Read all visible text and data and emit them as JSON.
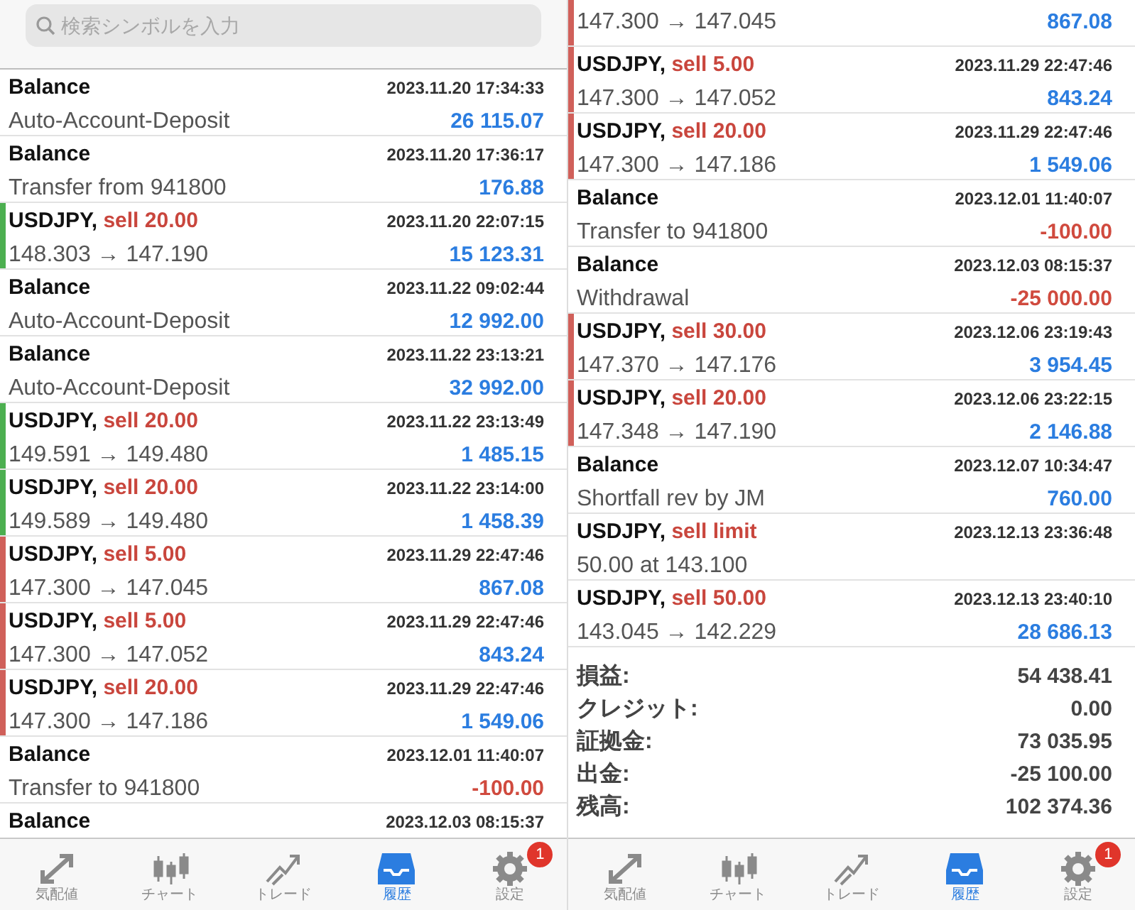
{
  "screens": [
    {
      "search": {
        "placeholder": "検索シンボルを入力"
      },
      "rows": [
        {
          "kind": "deal",
          "title": "Balance",
          "action": "",
          "time": "2023.11.20 17:34:33",
          "detail": "Auto-Account-Deposit",
          "amount": "26 115.07",
          "negative": false
        },
        {
          "kind": "deal",
          "title": "Balance",
          "action": "",
          "time": "2023.11.20 17:36:17",
          "detail": "Transfer from 941800",
          "amount": "176.88",
          "negative": false
        },
        {
          "kind": "deal",
          "title": "USDJPY,",
          "action": "sell 20.00",
          "time": "2023.11.20 22:07:15",
          "detail": "148.303 → 147.190",
          "amount": "15 123.31",
          "negative": false,
          "color": "#4caf50"
        },
        {
          "kind": "deal",
          "title": "Balance",
          "action": "",
          "time": "2023.11.22 09:02:44",
          "detail": "Auto-Account-Deposit",
          "amount": "12 992.00",
          "negative": false
        },
        {
          "kind": "deal",
          "title": "Balance",
          "action": "",
          "time": "2023.11.22 23:13:21",
          "detail": "Auto-Account-Deposit",
          "amount": "32 992.00",
          "negative": false
        },
        {
          "kind": "deal",
          "title": "USDJPY,",
          "action": "sell 20.00",
          "time": "2023.11.22 23:13:49",
          "detail": "149.591 → 149.480",
          "amount": "1 485.15",
          "negative": false,
          "color": "#4caf50"
        },
        {
          "kind": "deal",
          "title": "USDJPY,",
          "action": "sell 20.00",
          "time": "2023.11.22 23:14:00",
          "detail": "149.589 → 149.480",
          "amount": "1 458.39",
          "negative": false,
          "color": "#4caf50"
        },
        {
          "kind": "deal",
          "title": "USDJPY,",
          "action": "sell 5.00",
          "time": "2023.11.29 22:47:46",
          "detail": "147.300 → 147.045",
          "amount": "867.08",
          "negative": false,
          "color": "#d0605a"
        },
        {
          "kind": "deal",
          "title": "USDJPY,",
          "action": "sell 5.00",
          "time": "2023.11.29 22:47:46",
          "detail": "147.300 → 147.052",
          "amount": "843.24",
          "negative": false,
          "color": "#d0605a"
        },
        {
          "kind": "deal",
          "title": "USDJPY,",
          "action": "sell 20.00",
          "time": "2023.11.29 22:47:46",
          "detail": "147.300 → 147.186",
          "amount": "1 549.06",
          "negative": false,
          "color": "#d0605a"
        },
        {
          "kind": "deal",
          "title": "Balance",
          "action": "",
          "time": "2023.12.01 11:40:07",
          "detail": "Transfer to 941800",
          "amount": "-100.00",
          "negative": true
        },
        {
          "kind": "top",
          "title": "Balance",
          "action": "",
          "time": "2023.12.03 08:15:37"
        }
      ],
      "nav": [
        {
          "label": "気配値",
          "selected": false
        },
        {
          "label": "チャート",
          "selected": false
        },
        {
          "label": "トレード",
          "selected": false
        },
        {
          "label": "履歴",
          "selected": true
        },
        {
          "label": "設定",
          "selected": false,
          "badge": "1"
        }
      ]
    },
    {
      "rows": [
        {
          "kind": "bottom",
          "detail": "147.300 → 147.045",
          "amount": "867.08",
          "negative": false,
          "color": "#d0605a"
        },
        {
          "kind": "deal",
          "title": "USDJPY,",
          "action": "sell 5.00",
          "time": "2023.11.29 22:47:46",
          "detail": "147.300 → 147.052",
          "amount": "843.24",
          "negative": false,
          "color": "#d0605a"
        },
        {
          "kind": "deal",
          "title": "USDJPY,",
          "action": "sell 20.00",
          "time": "2023.11.29 22:47:46",
          "detail": "147.300 → 147.186",
          "amount": "1 549.06",
          "negative": false,
          "color": "#d0605a"
        },
        {
          "kind": "deal",
          "title": "Balance",
          "action": "",
          "time": "2023.12.01 11:40:07",
          "detail": "Transfer to 941800",
          "amount": "-100.00",
          "negative": true
        },
        {
          "kind": "deal",
          "title": "Balance",
          "action": "",
          "time": "2023.12.03 08:15:37",
          "detail": "Withdrawal",
          "amount": "-25 000.00",
          "negative": true
        },
        {
          "kind": "deal",
          "title": "USDJPY,",
          "action": "sell 30.00",
          "time": "2023.12.06 23:19:43",
          "detail": "147.370 → 147.176",
          "amount": "3 954.45",
          "negative": false,
          "color": "#d0605a"
        },
        {
          "kind": "deal",
          "title": "USDJPY,",
          "action": "sell 20.00",
          "time": "2023.12.06 23:22:15",
          "detail": "147.348 → 147.190",
          "amount": "2 146.88",
          "negative": false,
          "color": "#d0605a"
        },
        {
          "kind": "deal",
          "title": "Balance",
          "action": "",
          "time": "2023.12.07 10:34:47",
          "detail": "Shortfall rev by JM",
          "amount": "760.00",
          "negative": false
        },
        {
          "kind": "deal",
          "title": "USDJPY,",
          "action": "sell limit",
          "time": "2023.12.13 23:36:48",
          "detail": "50.00 at 143.100"
        },
        {
          "kind": "deal",
          "title": "USDJPY,",
          "action": "sell 50.00",
          "time": "2023.12.13 23:40:10",
          "detail": "143.045 → 142.229",
          "amount": "28 686.13",
          "negative": false
        }
      ],
      "summary": [
        {
          "label": "損益:",
          "value": "54 438.41"
        },
        {
          "label": "クレジット:",
          "value": "0.00"
        },
        {
          "label": "証拠金:",
          "value": "73 035.95"
        },
        {
          "label": "出金:",
          "value": "-25 100.00"
        },
        {
          "label": "残高:",
          "value": "102 374.36"
        }
      ],
      "nav": [
        {
          "label": "気配値",
          "selected": false
        },
        {
          "label": "チャート",
          "selected": false
        },
        {
          "label": "トレード",
          "selected": false
        },
        {
          "label": "履歴",
          "selected": true
        },
        {
          "label": "設定",
          "selected": false,
          "badge": "1"
        }
      ]
    }
  ]
}
